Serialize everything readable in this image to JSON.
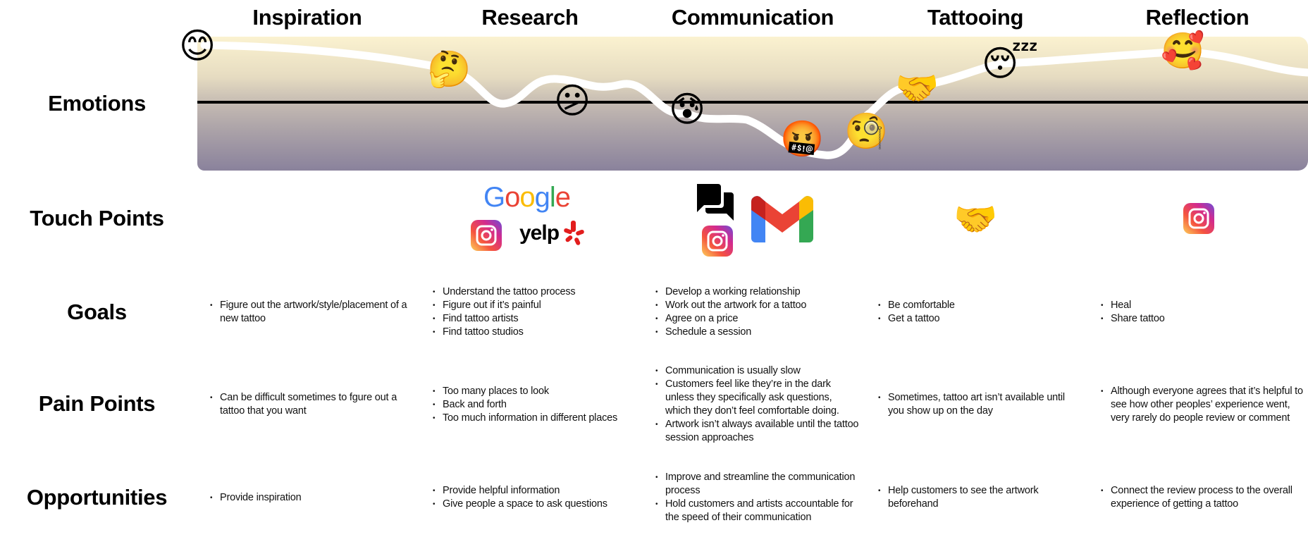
{
  "stages": [
    {
      "name": "Inspiration"
    },
    {
      "name": "Research"
    },
    {
      "name": "Communication"
    },
    {
      "name": "Tattooing"
    },
    {
      "name": "Reflection"
    }
  ],
  "row_labels": {
    "emotions": "Emotions",
    "touch_points": "Touch Points",
    "goals": "Goals",
    "pain_points": "Pain Points",
    "opportunities": "Opportunities"
  },
  "emotions": {
    "colors": {
      "band_top": "#fbf2d0",
      "band_bottom": "#8a829c",
      "curve": "#ffffff",
      "baseline": "#000000"
    },
    "points": [
      {
        "stage": "Inspiration",
        "emoji": "😊",
        "icon": "smiling-face-icon",
        "sentiment": "positive"
      },
      {
        "stage": "Research",
        "emoji": "🤔",
        "icon": "thinking-face-icon",
        "sentiment": "slightly positive"
      },
      {
        "stage": "Research",
        "emoji": "😕",
        "icon": "confused-face-icon",
        "sentiment": "neutral"
      },
      {
        "stage": "Communication",
        "emoji": "😰",
        "icon": "anxious-face-icon",
        "sentiment": "slightly negative"
      },
      {
        "stage": "Communication",
        "emoji": "🤬",
        "icon": "cursing-face-icon",
        "sentiment": "negative",
        "caption": "&$!#%"
      },
      {
        "stage": "Tattooing",
        "emoji": "🧐",
        "icon": "monocle-face-icon",
        "sentiment": "slightly negative"
      },
      {
        "stage": "Tattooing",
        "emoji": "🤝",
        "icon": "handshake-icon",
        "sentiment": "slightly positive"
      },
      {
        "stage": "Tattooing",
        "emoji": "😴",
        "icon": "sleeping-face-icon",
        "sentiment": "positive"
      },
      {
        "stage": "Reflection",
        "emoji": "🥰",
        "icon": "smiling-face-with-hearts-icon",
        "sentiment": "very positive"
      }
    ]
  },
  "touch_points": {
    "research": [
      {
        "label": "Google",
        "icon": "google-logo"
      },
      {
        "label": "Instagram",
        "icon": "instagram-icon"
      },
      {
        "label": "yelp",
        "icon": "yelp-logo"
      }
    ],
    "communication": [
      {
        "label": "Messages",
        "icon": "chat-bubbles-icon"
      },
      {
        "label": "Instagram",
        "icon": "instagram-icon"
      },
      {
        "label": "Gmail",
        "icon": "gmail-icon"
      }
    ],
    "tattooing": [
      {
        "label": "In person",
        "icon": "handshake-icon",
        "emoji": "🤝"
      }
    ],
    "reflection": [
      {
        "label": "Instagram",
        "icon": "instagram-icon"
      }
    ]
  },
  "goals": [
    [
      "Figure out the artwork/style/placement of a new tattoo"
    ],
    [
      "Understand the tattoo process",
      "Figure out if it’s painful",
      "Find tattoo artists",
      "Find tattoo studios"
    ],
    [
      "Develop a working relationship",
      "Work out the artwork for a tattoo",
      "Agree on a price",
      "Schedule a session"
    ],
    [
      "Be comfortable",
      "Get a tattoo"
    ],
    [
      "Heal",
      "Share tattoo"
    ]
  ],
  "pain_points": [
    [
      "Can be difficult sometimes to fgure out a tattoo that you want"
    ],
    [
      "Too many places to look",
      "Back and forth",
      "Too much information in different places"
    ],
    [
      "Communication is usually slow",
      "Customers feel like they’re in the dark unless they specifically ask questions, which they don’t feel comfortable doing.",
      "Artwork isn’t always available until the tattoo session approaches"
    ],
    [
      "Sometimes, tattoo art isn’t available until you show up on the day"
    ],
    [
      "Although everyone agrees that it’s helpful to see how other peoples’ experience went, very rarely do people review or comment"
    ]
  ],
  "opportunities": [
    [
      "Provide inspiration"
    ],
    [
      "Provide helpful information",
      "Give people a space to ask questions"
    ],
    [
      "Improve and streamline the communication process",
      "Hold customers and artists accountable for the speed of their communication"
    ],
    [
      "Help customers to see the artwork beforehand"
    ],
    [
      "Connect the review process to the overall experience of getting a tattoo"
    ]
  ]
}
